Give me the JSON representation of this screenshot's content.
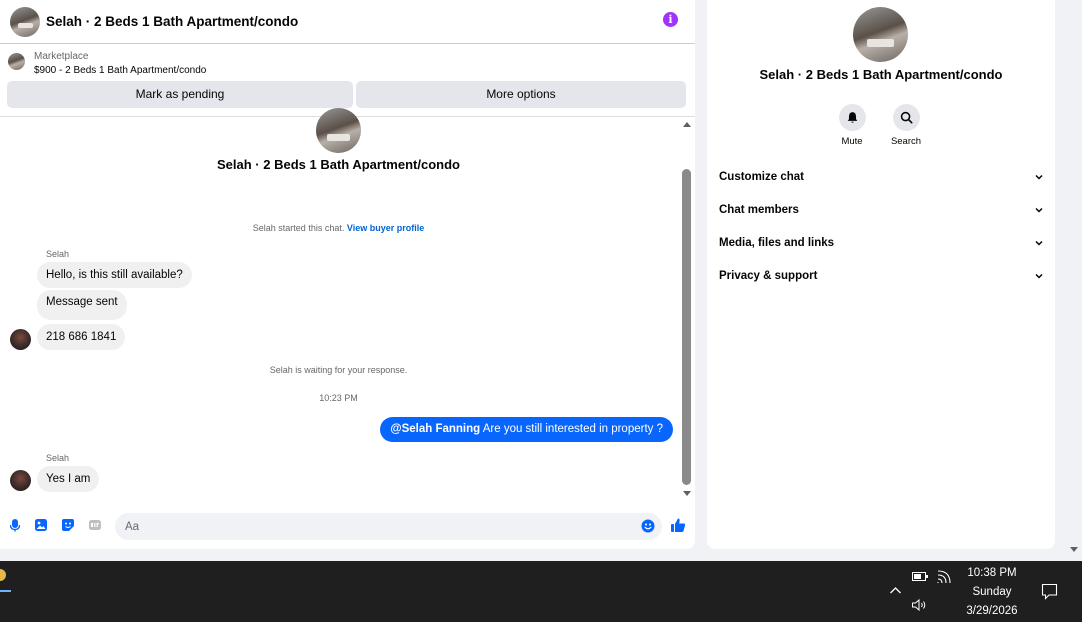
{
  "header": {
    "title": "Selah · 2 Beds 1 Bath Apartment/condo",
    "info_icon": "i"
  },
  "marketplace": {
    "label": "Marketplace",
    "listing": "$900 - 2 Beds 1 Bath Apartment/condo",
    "mark_pending_label": "Mark as pending",
    "more_options_label": "More options"
  },
  "conversation": {
    "center_name": "Selah · 2 Beds 1 Bath Apartment/condo",
    "started_text": "Selah started this chat.",
    "view_profile_link": "View buyer profile",
    "sender_name_1": "Selah",
    "messages_in": [
      "Hello, is this still available?",
      "Message sent",
      "218 686 1841"
    ],
    "waiting_text": "Selah is waiting for your response.",
    "timestamp": "10:23 PM",
    "outgoing_mention": "@Selah Fanning",
    "outgoing_text": " Are you still interested in property ?",
    "sender_name_2": "Selah",
    "reply": "Yes I am"
  },
  "composer": {
    "placeholder": "Aa"
  },
  "info_panel": {
    "name": "Selah · 2 Beds 1 Bath Apartment/condo",
    "mute_label": "Mute",
    "search_label": "Search",
    "sections": [
      "Customize chat",
      "Chat members",
      "Media, files and links",
      "Privacy & support"
    ]
  },
  "taskbar": {
    "time": "10:38 PM",
    "day": "Sunday",
    "date": "3/29/2026"
  },
  "colors": {
    "accent_blue": "#0866ff",
    "link_blue": "#0064d1",
    "info_purple": "#a033ff",
    "taskbar": "#1f1f1f"
  }
}
